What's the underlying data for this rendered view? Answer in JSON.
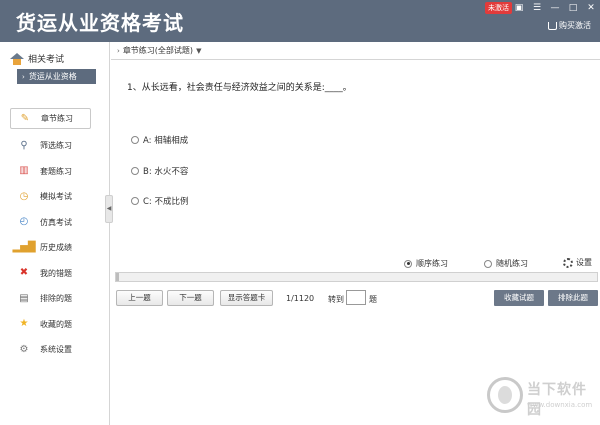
{
  "app": {
    "title": "货运从业资格考试",
    "badge": "未激活",
    "buy_label": "购买激活"
  },
  "sidebar": {
    "related_label": "相关考试",
    "subject": "货运从业资格",
    "items": [
      {
        "label": "章节练习",
        "icon": "pencil-icon",
        "active": true
      },
      {
        "label": "筛选练习",
        "icon": "magnifier-icon"
      },
      {
        "label": "套题练习",
        "icon": "books-icon"
      },
      {
        "label": "模拟考试",
        "icon": "clock-icon"
      },
      {
        "label": "仿真考试",
        "icon": "stopwatch-icon"
      },
      {
        "label": "历史成绩",
        "icon": "bar-chart-icon"
      },
      {
        "label": "我的错题",
        "icon": "red-x-icon"
      },
      {
        "label": "排除的题",
        "icon": "trash-icon"
      },
      {
        "label": "收藏的题",
        "icon": "star-icon"
      },
      {
        "label": "系统设置",
        "icon": "gear-icon"
      }
    ]
  },
  "breadcrumb": "章节练习(全部试题)",
  "question": {
    "text": "1、从长远看，社会责任与经济效益之间的关系是:____。",
    "options": [
      "A: 相辅相成",
      "B: 水火不容",
      "C: 不成比例"
    ]
  },
  "mode": {
    "sequential": "顺序练习",
    "random": "随机练习",
    "settings": "设置"
  },
  "nav": {
    "prev": "上一题",
    "next": "下一题",
    "answer_card": "显示答题卡",
    "counter": "1/1120",
    "goto_label": "转到",
    "goto_unit": "题",
    "favorite": "收藏试题",
    "exclude": "排除此题"
  },
  "watermark": {
    "name": "当下软件园",
    "url": "www.downxia.com"
  },
  "colors": {
    "titlebar": "#5d6b7e",
    "badge": "#e23b3b",
    "dark_button": "#6c7889"
  }
}
